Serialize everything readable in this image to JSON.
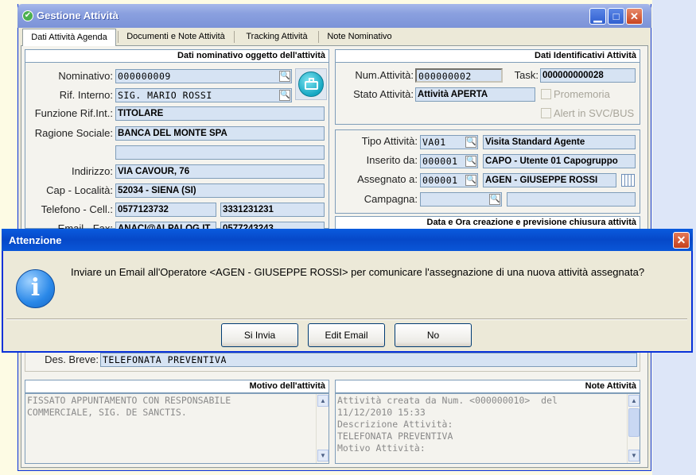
{
  "window": {
    "title": "Gestione Attività"
  },
  "tabs": [
    {
      "label": "Dati Attività Agenda"
    },
    {
      "label": "Documenti e Note Attività"
    },
    {
      "label": "Tracking Attività"
    },
    {
      "label": "Note Nominativo"
    }
  ],
  "nominativo": {
    "header": "Dati nominativo oggetto dell'attività",
    "nominativo_label": "Nominativo:",
    "nominativo_value": "000000009",
    "rif_interno_label": "Rif. Interno:",
    "rif_interno_value": "SIG. MARIO ROSSI",
    "funzione_label": "Funzione Rif.Int.:",
    "funzione_value": "TITOLARE",
    "ragione_label": "Ragione Sociale:",
    "ragione_value": "BANCA DEL MONTE SPA",
    "ragione_value2": "",
    "indirizzo_label": "Indirizzo:",
    "indirizzo_value": "VIA CAVOUR, 76",
    "cap_label": "Cap - Località:",
    "cap_value": "52034 - SIENA (SI)",
    "telefono_label": "Telefono - Cell.:",
    "telefono_value": "0577123732",
    "cell_value": "3331231231",
    "email_label": "Email - Fax:",
    "email_value": "ANACI@ALPALOG.IT",
    "fax_value": "0577243243"
  },
  "identificativi": {
    "header": "Dati Identificativi Attività",
    "num_label": "Num.Attività:",
    "num_value": "000000002",
    "task_label": "Task:",
    "task_value": "000000000028",
    "stato_label": "Stato Attività:",
    "stato_value": "Attività APERTA",
    "promemoria_label": "Promemoria",
    "alert_label": "Alert in SVC/BUS"
  },
  "tipo": {
    "tipo_label": "Tipo Attività:",
    "tipo_code": "VA01",
    "tipo_desc": "Visita Standard Agente",
    "inserito_label": "Inserito da:",
    "inserito_code": "000001",
    "inserito_desc": "CAPO - Utente 01 Capogruppo",
    "assegnato_label": "Assegnato a:",
    "assegnato_code": "000001",
    "assegnato_desc": "AGEN - GIUSEPPE ROSSI",
    "campagna_label": "Campagna:",
    "campagna_code": "",
    "campagna_desc": ""
  },
  "data_ora": {
    "header": "Data e Ora creazione e previsione chiusura attività"
  },
  "des_breve": {
    "label": "Des. Breve:",
    "value": "TELEFONATA PREVENTIVA"
  },
  "motivo": {
    "header": "Motivo dell'attività",
    "text": "FISSATO APPUNTAMENTO CON RESPONSABILE\nCOMMERCIALE, SIG. DE SANCTIS."
  },
  "note": {
    "header": "Note Attività",
    "text": "Attività creata da Num. <000000010>  del\n11/12/2010 15:33\nDescrizione Attività:\nTELEFONATA PREVENTIVA\nMotivo Attività:"
  },
  "dialog": {
    "title": "Attenzione",
    "message": "Inviare un Email all'Operatore <AGEN - GIUSEPPE ROSSI> per comunicare l'assegnazione di una nuova attività assegnata?",
    "buttons": {
      "si": "Si Invia",
      "edit": "Edit Email",
      "no": "No"
    }
  }
}
